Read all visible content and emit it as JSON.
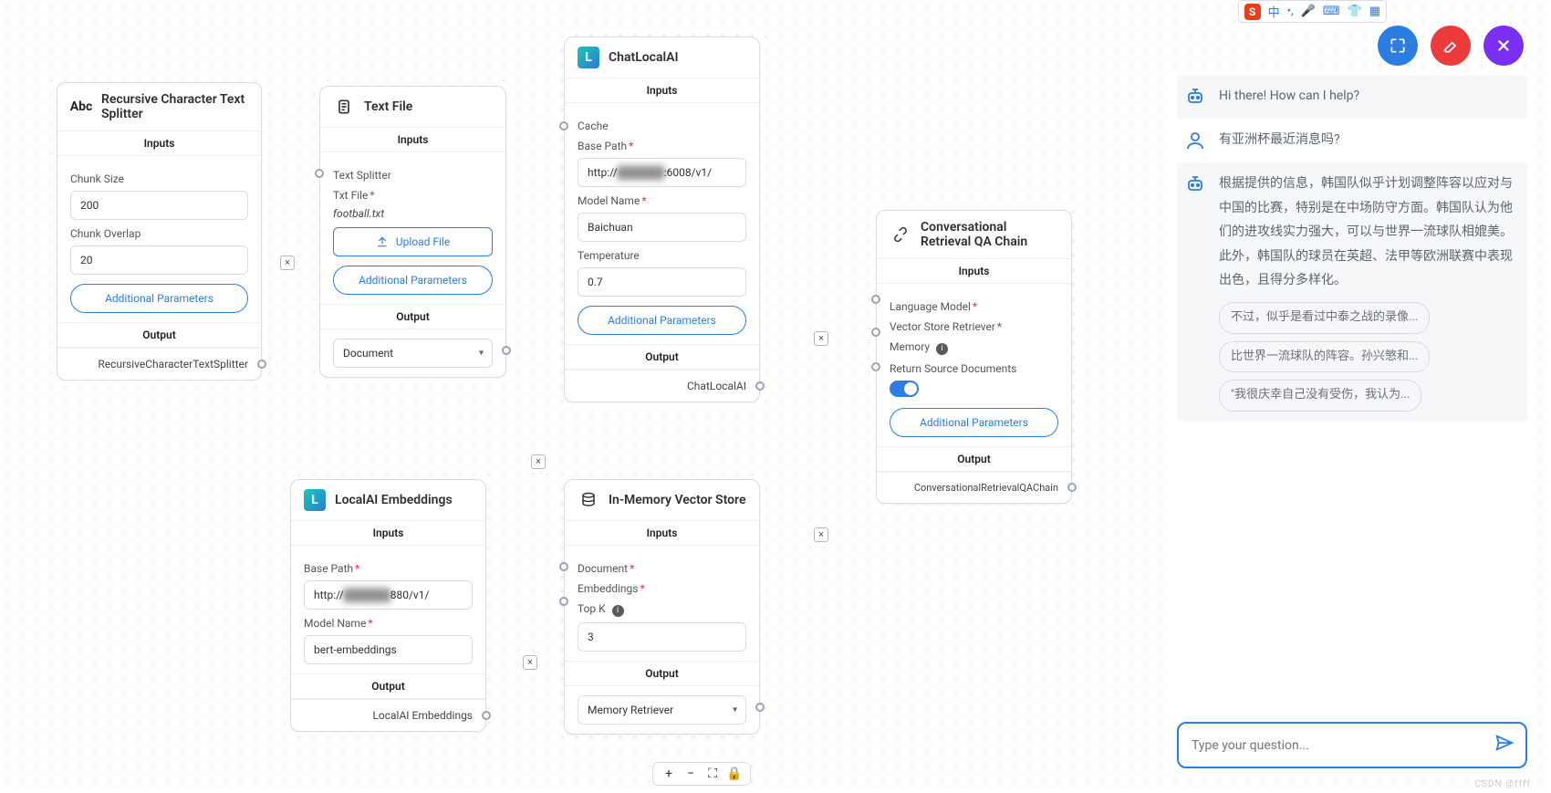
{
  "nodes": {
    "textSplitter": {
      "title": "Recursive Character Text Splitter",
      "iconText": "Abc",
      "inputsLabel": "Inputs",
      "chunkSizeLabel": "Chunk Size",
      "chunkSize": "200",
      "chunkOverlapLabel": "Chunk Overlap",
      "chunkOverlap": "20",
      "additionalParams": "Additional Parameters",
      "outputLabel": "Output",
      "outputName": "RecursiveCharacterTextSplitter"
    },
    "textFile": {
      "title": "Text File",
      "inputsLabel": "Inputs",
      "textSplitterLabel": "Text Splitter",
      "txtFileLabel": "Txt File",
      "fileName": "football.txt",
      "upload": "Upload File",
      "additionalParams": "Additional Parameters",
      "outputLabel": "Output",
      "selected": "Document"
    },
    "chatLocalAI": {
      "title": "ChatLocalAI",
      "inputsLabel": "Inputs",
      "cacheLabel": "Cache",
      "basePathLabel": "Base Path",
      "basePath": "http://",
      "basePathSuffix": ":6008/v1/",
      "modelNameLabel": "Model Name",
      "modelName": "Baichuan",
      "tempLabel": "Temperature",
      "temperature": "0.7",
      "additionalParams": "Additional Parameters",
      "outputLabel": "Output",
      "outputName": "ChatLocalAI"
    },
    "localEmbeddings": {
      "title": "LocalAI Embeddings",
      "inputsLabel": "Inputs",
      "basePathLabel": "Base Path",
      "basePath": "http://",
      "basePathSuffix": "880/v1/",
      "modelNameLabel": "Model Name",
      "modelName": "bert-embeddings",
      "outputLabel": "Output",
      "outputName": "LocalAI Embeddings"
    },
    "vectorStore": {
      "title": "In-Memory Vector Store",
      "inputsLabel": "Inputs",
      "documentLabel": "Document",
      "embeddingsLabel": "Embeddings",
      "topKLabel": "Top K",
      "topK": "3",
      "outputLabel": "Output",
      "selected": "Memory Retriever"
    },
    "qaChain": {
      "title": "Conversational Retrieval QA Chain",
      "inputsLabel": "Inputs",
      "lmLabel": "Language Model",
      "retrieverLabel": "Vector Store Retriever",
      "memoryLabel": "Memory",
      "returnSourceLabel": "Return Source Documents",
      "additionalParams": "Additional Parameters",
      "outputLabel": "Output",
      "outputName": "ConversationalRetrievalQAChain"
    }
  },
  "ime": {
    "lang": "中"
  },
  "chat": {
    "greeting": "Hi there! How can I help?",
    "userQuestion": "有亚洲杯最近消息吗?",
    "answer": "根据提供的信息，韩国队似乎计划调整阵容以应对与中国的比赛，特别是在中场防守方面。韩国队认为他们的进攻线实力强大，可以与世界一流球队相媲美。此外，韩国队的球员在英超、法甲等欧洲联赛中表现出色，且得分多样化。",
    "chips": [
      "不过，似乎是看过中泰之战的录像...",
      "比世界一流球队的阵容。孙兴慜和...",
      "\"我很庆幸自己没有受伤，我认为..."
    ],
    "placeholder": "Type your question...",
    "watermark": "CSDN @ffff"
  },
  "required": "*"
}
